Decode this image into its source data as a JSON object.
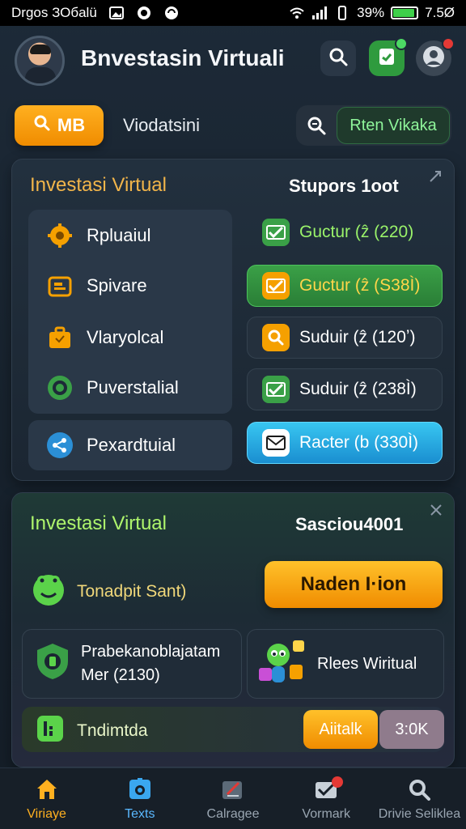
{
  "status_bar": {
    "time_label": "Drgos ЗОбalü",
    "battery": "39%",
    "battery_right": "7.5Ø"
  },
  "header": {
    "title": "Bnvestasin Virtuali"
  },
  "search_row": {
    "pill_label": "MB",
    "label": "Viodatsini",
    "field_value": "Rten Vikaka"
  },
  "card1": {
    "title": "Investasi Virtual",
    "right_title": "Stupors 1oot",
    "left_items": [
      {
        "label": "Rpluaiul",
        "icon": "gear-icon"
      },
      {
        "label": "Spivare",
        "icon": "folder-icon"
      },
      {
        "label": "Vlaryolcal",
        "icon": "briefcase-icon"
      },
      {
        "label": "Puverstalial",
        "icon": "cog-icon"
      }
    ],
    "bottom_item": {
      "label": "Pexardtuial",
      "icon": "share-icon"
    },
    "right_buttons": [
      {
        "label": "Guctur (ẑ (220)",
        "icon": "check-mail-icon"
      },
      {
        "label": "Guctur (ẑ (S38Ì)",
        "icon": "check-mail-icon"
      },
      {
        "label": "Suduir (ẑ (120ʼ)",
        "icon": "search-icon"
      },
      {
        "label": "Suduir (ẑ (238Ì)",
        "icon": "check-mail-icon"
      },
      {
        "label": "Racter (b (330Ì)",
        "icon": "mail-icon"
      }
    ]
  },
  "card2": {
    "title": "Investasi Virtual",
    "right_title": "Sasciou4001",
    "tiny_label": "Tonadpit Sant)",
    "orange_button": "Naden I·ion",
    "sub1_line1": "Prabekanoblajatam",
    "sub1_line2": "Mer (2130)",
    "sub2_label": "Rlees Wiritual",
    "bottom_label": "Tndimtda",
    "yellow_button": "Aiitalk",
    "grey_button": "3:0K"
  },
  "bottom_nav": [
    {
      "label": "Viriaye",
      "icon": "home-icon"
    },
    {
      "label": "Texts",
      "icon": "camera-icon"
    },
    {
      "label": "Calragee",
      "icon": "edit-icon"
    },
    {
      "label": "Vormark",
      "icon": "mail-check-icon"
    },
    {
      "label": "Drivie Seliklea",
      "icon": "search-icon"
    }
  ],
  "colors": {
    "accent_orange": "#f5a000",
    "accent_green": "#3aa047",
    "accent_blue": "#1fa6e0",
    "background": "#1b2632"
  }
}
